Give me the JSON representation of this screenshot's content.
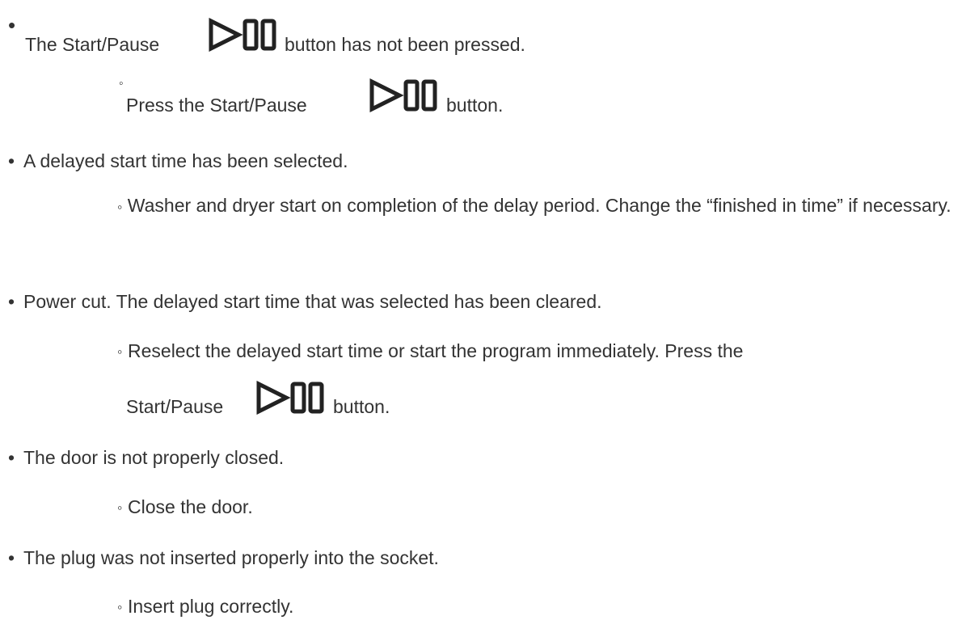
{
  "items": [
    {
      "bullet": "•",
      "text_before": "The Start/Pause",
      "icon": "play-pause-icon",
      "text_after": "button has not been pressed.",
      "sub": {
        "bullet": "◦",
        "text_before": "Press the Start/Pause",
        "icon": "play-pause-icon",
        "text_after": "button."
      }
    },
    {
      "bullet": "•",
      "text": "A delayed start time has been selected.",
      "sub": {
        "bullet": "◦",
        "text": "Washer and dryer start on completion of the delay period. Change the “finished in time” if necessary."
      }
    },
    {
      "bullet": "•",
      "text": "Power cut. The delayed start time that was selected has been cleared.",
      "sub": {
        "bullet": "◦",
        "text": "Reselect the delayed start time or start the program immediately. Press the",
        "line2_before": "Start/Pause",
        "icon": "play-pause-icon",
        "line2_after": "button."
      }
    },
    {
      "bullet": "•",
      "text": "The door is not properly closed.",
      "sub": {
        "bullet": "◦",
        "text": "Close the door."
      }
    },
    {
      "bullet": "•",
      "text": "The plug was not inserted properly into the socket.",
      "sub": {
        "bullet": "◦",
        "text": "Insert plug correctly."
      }
    }
  ]
}
